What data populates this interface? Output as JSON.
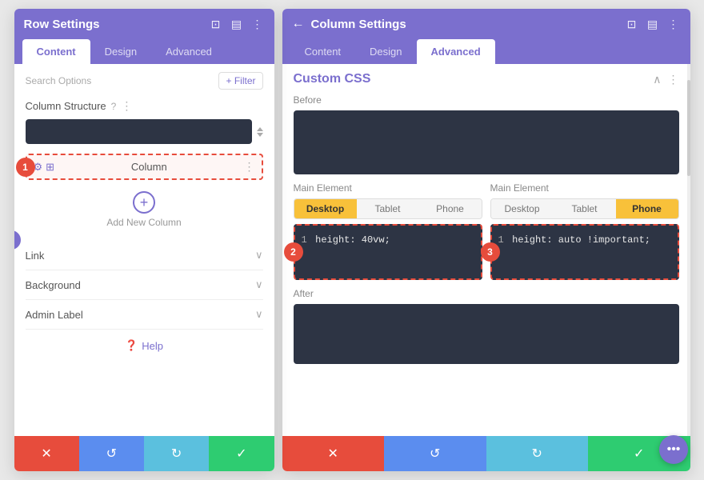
{
  "left_panel": {
    "title": "Row Settings",
    "tabs": [
      "Content",
      "Design",
      "Advanced"
    ],
    "active_tab": "Content",
    "search_placeholder": "Search Options",
    "filter_label": "+ Filter",
    "column_structure_label": "Column Structure",
    "column_select_value": "",
    "column_item_label": "Column",
    "add_column_label": "Add New Column",
    "link_label": "Link",
    "background_label": "Background",
    "admin_label_label": "Admin Label",
    "help_label": "Help",
    "badge_1": "1"
  },
  "right_panel": {
    "title": "Column Settings",
    "tabs": [
      "Content",
      "Design",
      "Advanced"
    ],
    "active_tab": "Advanced",
    "css_title": "Custom CSS",
    "before_label": "Before",
    "main_element_label": "Main Element",
    "after_label": "After",
    "device_tabs": [
      "Desktop",
      "Tablet",
      "Phone"
    ],
    "active_device_left": "Desktop",
    "active_device_right": "Phone",
    "code_left": "1  height: 40vw;",
    "code_right": "1  height: auto !important;",
    "badge_2": "2",
    "badge_3": "3"
  },
  "footer": {
    "cancel_icon": "✕",
    "undo_icon": "↺",
    "redo_icon": "↻",
    "save_icon": "✓"
  },
  "floating_dots": "•••"
}
